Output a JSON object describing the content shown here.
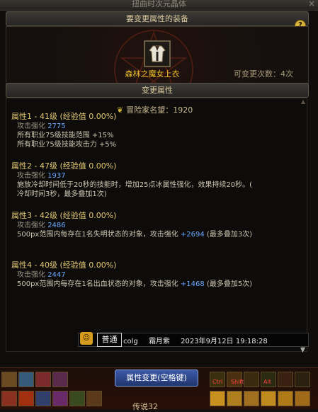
{
  "window": {
    "title": "扭曲时次元晶体",
    "close_glyph": "×"
  },
  "equipment": {
    "header": "要变更属性的装备",
    "help_label": "?",
    "item_name": "森林之魔女上衣",
    "change_count": "可变更次数：4次"
  },
  "attributes": {
    "header": "变更属性",
    "reputation": "冒险家名望：1920",
    "items": [
      {
        "head": "属性1 - 41级 (经验值 0.00%)",
        "label": "攻击强化",
        "value": "2775",
        "lines": [
          "所有职业75级技能范围 +15%",
          "所有职业75级技能攻击力 +5%"
        ]
      },
      {
        "head": "属性2 - 47级 (经验值 0.00%)",
        "label": "攻击强化",
        "value": "1937",
        "lines": [
          "施放冷却时间低于20秒的技能时，增加25点冰属性强化，效果持续20秒。(",
          "冷却时间3秒，最多叠加1次)"
        ]
      },
      {
        "head": "属性3 - 42级 (经验值 0.00%)",
        "label": "攻击强化",
        "value": "2486",
        "line_pre": "500px范围内每存在1名失明状态的对象，攻击强化",
        "line_num": "+2694",
        "line_post": "(最多叠加3次)"
      },
      {
        "head": "属性4 - 40级 (经验值 0.00%)",
        "label": "攻击强化",
        "value": "2447",
        "line_pre": "500px范围内每存在1名出血状态的对象，攻击强化",
        "line_num": "+1468",
        "line_post": "(最多叠加5次)"
      }
    ]
  },
  "chat": {
    "channel": "普通",
    "user": "colg",
    "name": "霜月紫",
    "timestamp": "2023年9月12日 19:18:28"
  },
  "bottom": {
    "change_button": "属性变更(空格键)",
    "level": "传说32",
    "keys": [
      "Ctrl",
      "Shift",
      "Alt"
    ]
  },
  "colors": {
    "accent_gold": "#f0c22a",
    "value_blue": "#6aa9ff",
    "button_blue": "#2f4b92"
  }
}
